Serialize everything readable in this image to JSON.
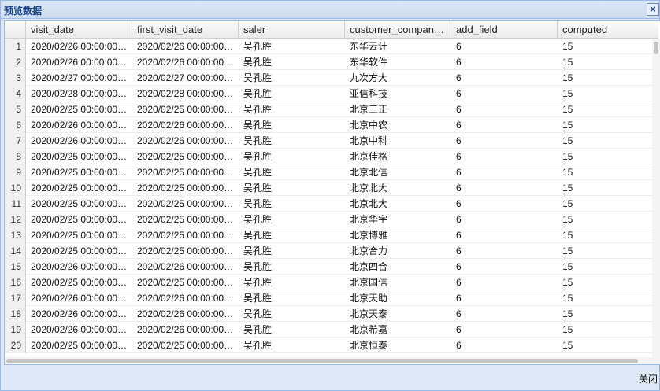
{
  "window": {
    "title": "预览数据",
    "close_icon": "×",
    "footer_close_label": "关闭"
  },
  "grid": {
    "columns": [
      "visit_date",
      "first_visit_date",
      "saler",
      "customer_compan…",
      "add_field",
      "computed"
    ],
    "rows": [
      {
        "n": "1",
        "visit_date": "2020/02/26 00:00:00…",
        "first_visit_date": "2020/02/26 00:00:00…",
        "saler": "吴孔胜",
        "customer": "东华云计",
        "add_field": "6",
        "computed": "15"
      },
      {
        "n": "2",
        "visit_date": "2020/02/26 00:00:00…",
        "first_visit_date": "2020/02/26 00:00:00…",
        "saler": "吴孔胜",
        "customer": "东华软件",
        "add_field": "6",
        "computed": "15"
      },
      {
        "n": "3",
        "visit_date": "2020/02/27 00:00:00…",
        "first_visit_date": "2020/02/27 00:00:00…",
        "saler": "吴孔胜",
        "customer": "九次方大",
        "add_field": "6",
        "computed": "15"
      },
      {
        "n": "4",
        "visit_date": "2020/02/28 00:00:00…",
        "first_visit_date": "2020/02/28 00:00:00…",
        "saler": "吴孔胜",
        "customer": "亚信科技",
        "add_field": "6",
        "computed": "15"
      },
      {
        "n": "5",
        "visit_date": "2020/02/25 00:00:00…",
        "first_visit_date": "2020/02/25 00:00:00…",
        "saler": "吴孔胜",
        "customer": "北京三正",
        "add_field": "6",
        "computed": "15"
      },
      {
        "n": "6",
        "visit_date": "2020/02/26 00:00:00…",
        "first_visit_date": "2020/02/26 00:00:00…",
        "saler": "吴孔胜",
        "customer": "北京中农",
        "add_field": "6",
        "computed": "15"
      },
      {
        "n": "7",
        "visit_date": "2020/02/26 00:00:00…",
        "first_visit_date": "2020/02/26 00:00:00…",
        "saler": "吴孔胜",
        "customer": "北京中科",
        "add_field": "6",
        "computed": "15"
      },
      {
        "n": "8",
        "visit_date": "2020/02/25 00:00:00…",
        "first_visit_date": "2020/02/25 00:00:00…",
        "saler": "吴孔胜",
        "customer": "北京佳格",
        "add_field": "6",
        "computed": "15"
      },
      {
        "n": "9",
        "visit_date": "2020/02/25 00:00:00…",
        "first_visit_date": "2020/02/25 00:00:00…",
        "saler": "吴孔胜",
        "customer": "北京北信",
        "add_field": "6",
        "computed": "15"
      },
      {
        "n": "10",
        "visit_date": "2020/02/25 00:00:00…",
        "first_visit_date": "2020/02/25 00:00:00…",
        "saler": "吴孔胜",
        "customer": "北京北大",
        "add_field": "6",
        "computed": "15"
      },
      {
        "n": "11",
        "visit_date": "2020/02/25 00:00:00…",
        "first_visit_date": "2020/02/25 00:00:00…",
        "saler": "吴孔胜",
        "customer": "北京北大",
        "add_field": "6",
        "computed": "15"
      },
      {
        "n": "12",
        "visit_date": "2020/02/25 00:00:00…",
        "first_visit_date": "2020/02/25 00:00:00…",
        "saler": "吴孔胜",
        "customer": "北京华宇",
        "add_field": "6",
        "computed": "15"
      },
      {
        "n": "13",
        "visit_date": "2020/02/25 00:00:00…",
        "first_visit_date": "2020/02/25 00:00:00…",
        "saler": "吴孔胜",
        "customer": "北京博雅",
        "add_field": "6",
        "computed": "15"
      },
      {
        "n": "14",
        "visit_date": "2020/02/25 00:00:00…",
        "first_visit_date": "2020/02/25 00:00:00…",
        "saler": "吴孔胜",
        "customer": "北京合力",
        "add_field": "6",
        "computed": "15"
      },
      {
        "n": "15",
        "visit_date": "2020/02/26 00:00:00…",
        "first_visit_date": "2020/02/26 00:00:00…",
        "saler": "吴孔胜",
        "customer": "北京四合",
        "add_field": "6",
        "computed": "15"
      },
      {
        "n": "16",
        "visit_date": "2020/02/25 00:00:00…",
        "first_visit_date": "2020/02/25 00:00:00…",
        "saler": "吴孔胜",
        "customer": "北京国信",
        "add_field": "6",
        "computed": "15"
      },
      {
        "n": "17",
        "visit_date": "2020/02/26 00:00:00…",
        "first_visit_date": "2020/02/26 00:00:00…",
        "saler": "吴孔胜",
        "customer": "北京天助",
        "add_field": "6",
        "computed": "15"
      },
      {
        "n": "18",
        "visit_date": "2020/02/26 00:00:00…",
        "first_visit_date": "2020/02/26 00:00:00…",
        "saler": "吴孔胜",
        "customer": "北京天泰",
        "add_field": "6",
        "computed": "15"
      },
      {
        "n": "19",
        "visit_date": "2020/02/26 00:00:00…",
        "first_visit_date": "2020/02/26 00:00:00…",
        "saler": "吴孔胜",
        "customer": "北京希嘉",
        "add_field": "6",
        "computed": "15"
      },
      {
        "n": "20",
        "visit_date": "2020/02/25 00:00:00…",
        "first_visit_date": "2020/02/25 00:00:00…",
        "saler": "吴孔胜",
        "customer": "北京恒泰",
        "add_field": "6",
        "computed": "15"
      }
    ]
  }
}
